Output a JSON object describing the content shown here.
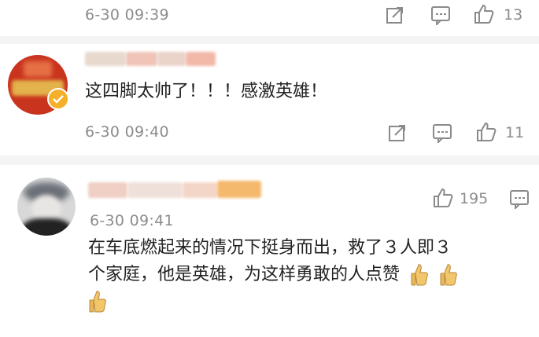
{
  "top_item": {
    "timestamp": "6-30 09:39",
    "like_count": "13"
  },
  "comment1": {
    "text": "这四脚太帅了！！！感激英雄！",
    "timestamp": "6-30 09:40",
    "like_count": "11"
  },
  "comment2": {
    "timestamp": "6-30 09:41",
    "like_count": "195",
    "text_line1": "在车底燃起来的情况下挺身而出，救了３人即３",
    "text_line2": "个家庭，他是英雄，为这样勇敢的人点赞"
  },
  "colors": {
    "meta_gray": "#8c8c8c",
    "icon_gray": "#8a8a8a",
    "text": "#222222",
    "divider": "#f4f4f4",
    "emoji_yellow": "#f2c66b"
  },
  "icons": [
    "share-icon",
    "comment-icon",
    "thumbs-up-icon",
    "thumbs-up-emoji"
  ]
}
